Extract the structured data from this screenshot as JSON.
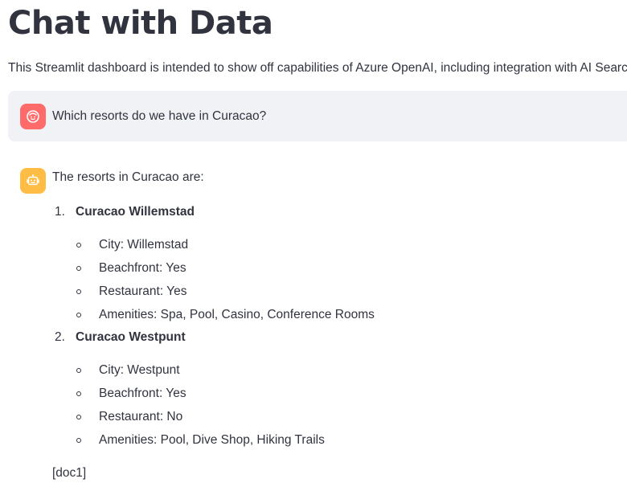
{
  "header": {
    "title": "Chat with Data",
    "subtitle": "This Streamlit dashboard is intended to show off capabilities of Azure OpenAI, including integration with AI Search."
  },
  "user_message": {
    "avatar_icon": "face-icon",
    "avatar_color": "#ff6b6b",
    "text": "Which resorts do we have in Curacao?"
  },
  "assistant_message": {
    "avatar_icon": "robot-icon",
    "avatar_color": "#ffbd45",
    "intro": "The resorts in Curacao are:",
    "resorts": [
      {
        "number": "1.",
        "name": "Curacao Willemstad",
        "details": [
          "City: Willemstad",
          "Beachfront: Yes",
          "Restaurant: Yes",
          "Amenities: Spa, Pool, Casino, Conference Rooms"
        ]
      },
      {
        "number": "2.",
        "name": "Curacao Westpunt",
        "details": [
          "City: Westpunt",
          "Beachfront: Yes",
          "Restaurant: No",
          "Amenities: Pool, Dive Shop, Hiking Trails"
        ]
      }
    ],
    "citation": "[doc1]"
  }
}
